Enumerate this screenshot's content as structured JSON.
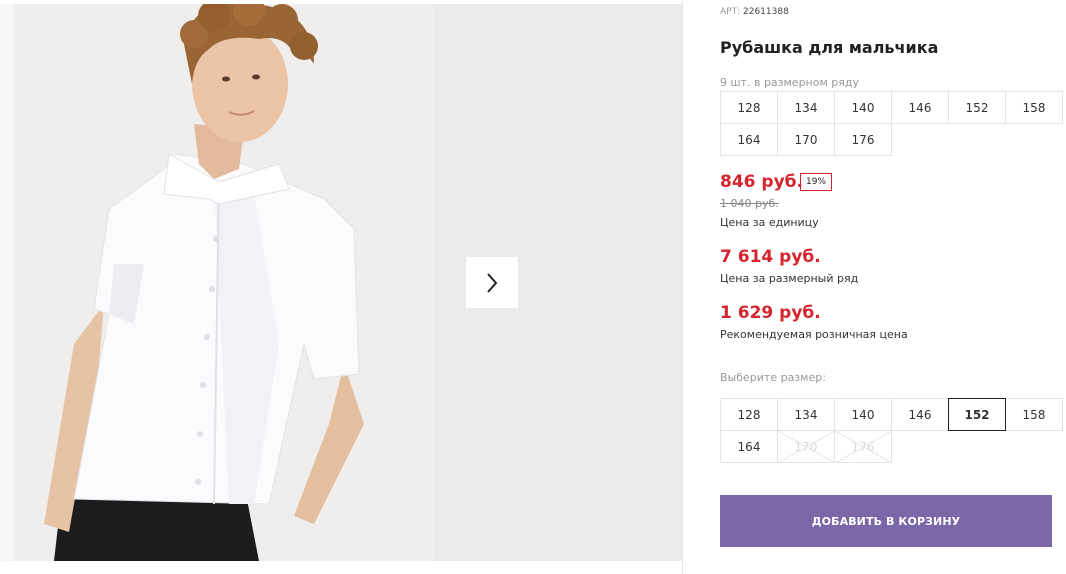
{
  "product": {
    "sku_label": "АРТ:",
    "sku": "22611388",
    "title": "Рубашка для мальчика",
    "row_note": "9 шт. в размерном ряду",
    "size_row": [
      "128",
      "134",
      "140",
      "146",
      "152",
      "158",
      "164",
      "170",
      "176"
    ]
  },
  "pricing": {
    "unit_price": "846 руб.",
    "discount": "19%",
    "old_price": "1 040 руб.",
    "unit_caption": "Цена за единицу",
    "row_price": "7 614 руб.",
    "row_caption": "Цена за размерный ряд",
    "retail_price": "1 629 руб.",
    "retail_caption": "Рекомендуемая розничная цена"
  },
  "size_select": {
    "label": "Выберите размер:",
    "selected": "152",
    "options": [
      {
        "size": "128",
        "available": true
      },
      {
        "size": "134",
        "available": true
      },
      {
        "size": "140",
        "available": true
      },
      {
        "size": "146",
        "available": true
      },
      {
        "size": "152",
        "available": true
      },
      {
        "size": "158",
        "available": true
      },
      {
        "size": "164",
        "available": true
      },
      {
        "size": "170",
        "available": false
      },
      {
        "size": "176",
        "available": false
      }
    ]
  },
  "cart": {
    "add_label": "ДОБАВИТЬ В КОРЗИНУ"
  },
  "gallery": {
    "next_icon": "chevron-right-icon"
  },
  "colors": {
    "price": "#d4242d",
    "button": "#7b67a7"
  }
}
